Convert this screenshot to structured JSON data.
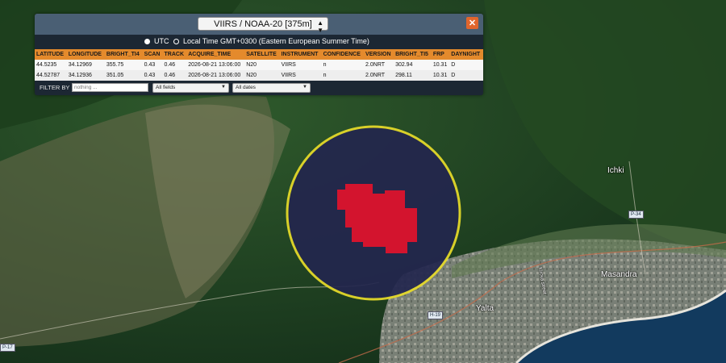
{
  "layer": {
    "selected": "VIIRS / NOAA-20 [375m]",
    "chevron_icon": "chevron-updown-icon"
  },
  "close_icon": "close-icon",
  "time_mode": {
    "utc_label": "UTC",
    "local_label": "Local Time GMT+0300 (Eastern European Summer Time)",
    "selected": "UTC"
  },
  "table": {
    "columns": [
      "LATITUDE",
      "LONGITUDE",
      "BRIGHT_TI4",
      "SCAN",
      "TRACK",
      "ACQUIRE_TIME",
      "SATELLITE",
      "INSTRUMENT",
      "CONFIDENCE",
      "VERSION",
      "BRIGHT_TI5",
      "FRP",
      "DAYNIGHT"
    ],
    "rows": [
      [
        "44.5235",
        "34.12969",
        "355.75",
        "0.43",
        "0.46",
        "2026-08-21 13:06:00",
        "N20",
        "VIIRS",
        "n",
        "2.0NRT",
        "302.94",
        "10.31",
        "D"
      ],
      [
        "44.52787",
        "34.12936",
        "351.05",
        "0.43",
        "0.46",
        "2026-08-21 13:06:00",
        "N20",
        "VIIRS",
        "n",
        "2.0NRT",
        "298.11",
        "10.31",
        "D"
      ]
    ]
  },
  "filter": {
    "label": "FILTER BY",
    "placeholder": "nothing ...",
    "field_select": "All fields",
    "date_select": "All dates"
  },
  "map": {
    "places": [
      "Ichki",
      "Masandra",
      "Yalta"
    ],
    "roads": [
      "P-34",
      "H-19",
      "P-17"
    ],
    "street_label": "Kirova street",
    "colors": {
      "highlight_ring": "#e8dc2a",
      "fire_pixels": "#d3142e",
      "highlight_fill": "#23264e",
      "sea": "#123a5e"
    }
  }
}
